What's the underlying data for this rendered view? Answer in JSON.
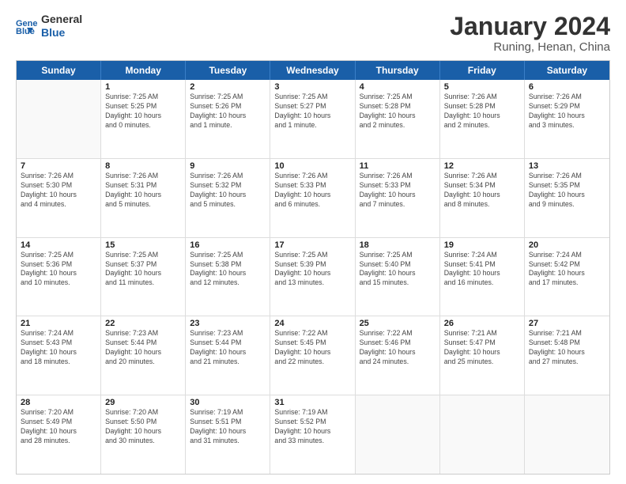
{
  "logo": {
    "line1": "General",
    "line2": "Blue"
  },
  "title": "January 2024",
  "subtitle": "Runing, Henan, China",
  "days": [
    "Sunday",
    "Monday",
    "Tuesday",
    "Wednesday",
    "Thursday",
    "Friday",
    "Saturday"
  ],
  "weeks": [
    [
      {
        "day": "",
        "info": ""
      },
      {
        "day": "1",
        "info": "Sunrise: 7:25 AM\nSunset: 5:25 PM\nDaylight: 10 hours\nand 0 minutes."
      },
      {
        "day": "2",
        "info": "Sunrise: 7:25 AM\nSunset: 5:26 PM\nDaylight: 10 hours\nand 1 minute."
      },
      {
        "day": "3",
        "info": "Sunrise: 7:25 AM\nSunset: 5:27 PM\nDaylight: 10 hours\nand 1 minute."
      },
      {
        "day": "4",
        "info": "Sunrise: 7:25 AM\nSunset: 5:28 PM\nDaylight: 10 hours\nand 2 minutes."
      },
      {
        "day": "5",
        "info": "Sunrise: 7:26 AM\nSunset: 5:28 PM\nDaylight: 10 hours\nand 2 minutes."
      },
      {
        "day": "6",
        "info": "Sunrise: 7:26 AM\nSunset: 5:29 PM\nDaylight: 10 hours\nand 3 minutes."
      }
    ],
    [
      {
        "day": "7",
        "info": "Sunrise: 7:26 AM\nSunset: 5:30 PM\nDaylight: 10 hours\nand 4 minutes."
      },
      {
        "day": "8",
        "info": "Sunrise: 7:26 AM\nSunset: 5:31 PM\nDaylight: 10 hours\nand 5 minutes."
      },
      {
        "day": "9",
        "info": "Sunrise: 7:26 AM\nSunset: 5:32 PM\nDaylight: 10 hours\nand 5 minutes."
      },
      {
        "day": "10",
        "info": "Sunrise: 7:26 AM\nSunset: 5:33 PM\nDaylight: 10 hours\nand 6 minutes."
      },
      {
        "day": "11",
        "info": "Sunrise: 7:26 AM\nSunset: 5:33 PM\nDaylight: 10 hours\nand 7 minutes."
      },
      {
        "day": "12",
        "info": "Sunrise: 7:26 AM\nSunset: 5:34 PM\nDaylight: 10 hours\nand 8 minutes."
      },
      {
        "day": "13",
        "info": "Sunrise: 7:26 AM\nSunset: 5:35 PM\nDaylight: 10 hours\nand 9 minutes."
      }
    ],
    [
      {
        "day": "14",
        "info": "Sunrise: 7:25 AM\nSunset: 5:36 PM\nDaylight: 10 hours\nand 10 minutes."
      },
      {
        "day": "15",
        "info": "Sunrise: 7:25 AM\nSunset: 5:37 PM\nDaylight: 10 hours\nand 11 minutes."
      },
      {
        "day": "16",
        "info": "Sunrise: 7:25 AM\nSunset: 5:38 PM\nDaylight: 10 hours\nand 12 minutes."
      },
      {
        "day": "17",
        "info": "Sunrise: 7:25 AM\nSunset: 5:39 PM\nDaylight: 10 hours\nand 13 minutes."
      },
      {
        "day": "18",
        "info": "Sunrise: 7:25 AM\nSunset: 5:40 PM\nDaylight: 10 hours\nand 15 minutes."
      },
      {
        "day": "19",
        "info": "Sunrise: 7:24 AM\nSunset: 5:41 PM\nDaylight: 10 hours\nand 16 minutes."
      },
      {
        "day": "20",
        "info": "Sunrise: 7:24 AM\nSunset: 5:42 PM\nDaylight: 10 hours\nand 17 minutes."
      }
    ],
    [
      {
        "day": "21",
        "info": "Sunrise: 7:24 AM\nSunset: 5:43 PM\nDaylight: 10 hours\nand 18 minutes."
      },
      {
        "day": "22",
        "info": "Sunrise: 7:23 AM\nSunset: 5:44 PM\nDaylight: 10 hours\nand 20 minutes."
      },
      {
        "day": "23",
        "info": "Sunrise: 7:23 AM\nSunset: 5:44 PM\nDaylight: 10 hours\nand 21 minutes."
      },
      {
        "day": "24",
        "info": "Sunrise: 7:22 AM\nSunset: 5:45 PM\nDaylight: 10 hours\nand 22 minutes."
      },
      {
        "day": "25",
        "info": "Sunrise: 7:22 AM\nSunset: 5:46 PM\nDaylight: 10 hours\nand 24 minutes."
      },
      {
        "day": "26",
        "info": "Sunrise: 7:21 AM\nSunset: 5:47 PM\nDaylight: 10 hours\nand 25 minutes."
      },
      {
        "day": "27",
        "info": "Sunrise: 7:21 AM\nSunset: 5:48 PM\nDaylight: 10 hours\nand 27 minutes."
      }
    ],
    [
      {
        "day": "28",
        "info": "Sunrise: 7:20 AM\nSunset: 5:49 PM\nDaylight: 10 hours\nand 28 minutes."
      },
      {
        "day": "29",
        "info": "Sunrise: 7:20 AM\nSunset: 5:50 PM\nDaylight: 10 hours\nand 30 minutes."
      },
      {
        "day": "30",
        "info": "Sunrise: 7:19 AM\nSunset: 5:51 PM\nDaylight: 10 hours\nand 31 minutes."
      },
      {
        "day": "31",
        "info": "Sunrise: 7:19 AM\nSunset: 5:52 PM\nDaylight: 10 hours\nand 33 minutes."
      },
      {
        "day": "",
        "info": ""
      },
      {
        "day": "",
        "info": ""
      },
      {
        "day": "",
        "info": ""
      }
    ]
  ]
}
